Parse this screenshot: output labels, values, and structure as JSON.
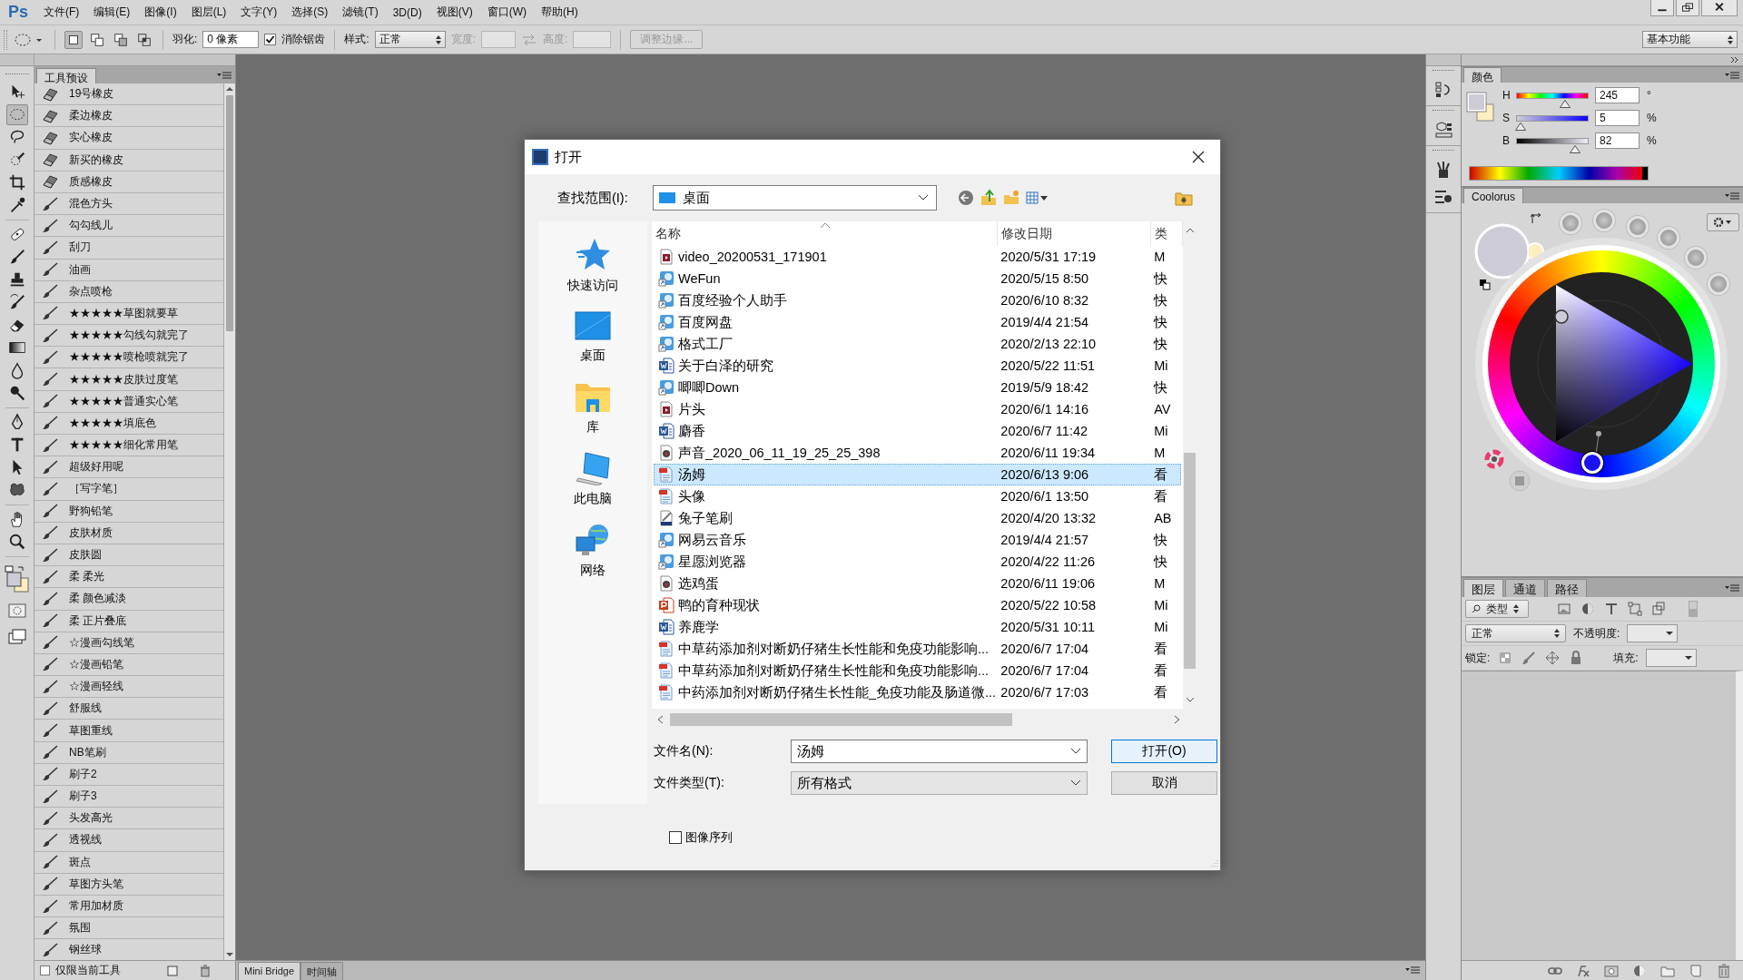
{
  "menu_bar": {
    "logo": "Ps",
    "items": [
      "文件(F)",
      "编辑(E)",
      "图像(I)",
      "图层(L)",
      "文字(Y)",
      "选择(S)",
      "滤镜(T)",
      "3D(D)",
      "视图(V)",
      "窗口(W)",
      "帮助(H)"
    ]
  },
  "options_bar": {
    "selection_modes": [
      {
        "selected": true
      },
      {
        "selected": false
      },
      {
        "selected": false
      },
      {
        "selected": false
      }
    ],
    "feather_label": "羽化:",
    "feather_value": "0 像素",
    "antialias": {
      "label": "消除锯齿",
      "checked": true
    },
    "style_label": "样式:",
    "style_value": "正常",
    "width_field": {
      "label": "宽度:",
      "disabled": true
    },
    "height_field": {
      "label": "高度:",
      "disabled": true
    },
    "refine_edge": {
      "label": "调整边缘...",
      "disabled": true
    },
    "workspace": "基本功能"
  },
  "tools": [
    {
      "selected": false
    },
    {
      "selected": true
    },
    {
      "selected": false
    },
    {
      "selected": false
    },
    {
      "selected": false
    },
    {
      "selected": false
    },
    {
      "selected": false
    },
    {
      "selected": false
    },
    {
      "selected": false
    },
    {
      "selected": false
    },
    {
      "selected": false
    },
    {
      "selected": false
    },
    {
      "selected": false
    },
    {
      "selected": false
    },
    {
      "selected": false
    },
    {
      "selected": false
    },
    {
      "selected": false
    },
    {
      "selected": false
    },
    {
      "selected": false
    },
    {
      "selected": false
    }
  ],
  "tool_presets": {
    "title": "工具预设",
    "items": [
      {
        "label": "19号橡皮",
        "kind": "eraser"
      },
      {
        "label": "柔边橡皮",
        "kind": "eraser"
      },
      {
        "label": "实心橡皮",
        "kind": "eraser"
      },
      {
        "label": "新买的橡皮",
        "kind": "eraser"
      },
      {
        "label": "质感橡皮",
        "kind": "eraser"
      },
      {
        "label": "混色方头",
        "kind": "brush"
      },
      {
        "label": "勾勾线儿",
        "kind": "brush"
      },
      {
        "label": "刮刀",
        "kind": "brush"
      },
      {
        "label": "油画",
        "kind": "brush"
      },
      {
        "label": "杂点喷枪",
        "kind": "brush"
      },
      {
        "label": "★★★★★草图就要草",
        "kind": "brush"
      },
      {
        "label": "★★★★★勾线勾就完了",
        "kind": "brush"
      },
      {
        "label": "★★★★★喷枪喷就完了",
        "kind": "brush"
      },
      {
        "label": "★★★★★皮肤过度笔",
        "kind": "brush"
      },
      {
        "label": "★★★★★普通实心笔",
        "kind": "brush"
      },
      {
        "label": "★★★★★填底色",
        "kind": "brush"
      },
      {
        "label": "★★★★★细化常用笔",
        "kind": "brush"
      },
      {
        "label": "超级好用呢",
        "kind": "brush"
      },
      {
        "label": "［写字笔］",
        "kind": "brush"
      },
      {
        "label": "野狗铅笔",
        "kind": "brush"
      },
      {
        "label": "皮肤材质",
        "kind": "brush"
      },
      {
        "label": "皮肤圆",
        "kind": "brush"
      },
      {
        "label": "柔 柔光",
        "kind": "brush"
      },
      {
        "label": "柔 颜色减淡",
        "kind": "brush"
      },
      {
        "label": "柔 正片叠底",
        "kind": "brush"
      },
      {
        "label": "☆漫画勾线笔",
        "kind": "brush"
      },
      {
        "label": "☆漫画铅笔",
        "kind": "brush"
      },
      {
        "label": "☆漫画轻线",
        "kind": "brush"
      },
      {
        "label": "舒服线",
        "kind": "brush"
      },
      {
        "label": "草图重线",
        "kind": "brush"
      },
      {
        "label": "NB笔刷",
        "kind": "brush"
      },
      {
        "label": "刷子2",
        "kind": "brush"
      },
      {
        "label": "刷子3",
        "kind": "brush"
      },
      {
        "label": "头发高光",
        "kind": "brush"
      },
      {
        "label": "透视线",
        "kind": "brush"
      },
      {
        "label": "斑点",
        "kind": "brush"
      },
      {
        "label": "草图方头笔",
        "kind": "brush"
      },
      {
        "label": "常用加材质",
        "kind": "brush"
      },
      {
        "label": "氛围",
        "kind": "brush"
      },
      {
        "label": "钢丝球",
        "kind": "brush"
      }
    ],
    "current_tool_only": {
      "label": "仅限当前工具",
      "checked": false
    }
  },
  "open_dialog": {
    "title": "打开",
    "look_in_label": "查找范围(I):",
    "look_in_value": "桌面",
    "places": [
      {
        "label": "快速访问",
        "kind": "quick"
      },
      {
        "label": "桌面",
        "kind": "desktop"
      },
      {
        "label": "库",
        "kind": "library"
      },
      {
        "label": "此电脑",
        "kind": "computer"
      },
      {
        "label": "网络",
        "kind": "network"
      }
    ],
    "columns": [
      "名称",
      "修改日期",
      "类"
    ],
    "rows": [
      {
        "name": "video_20200531_171901",
        "date": "2020/5/31 17:19",
        "type": "M",
        "kind": "video",
        "selected": false
      },
      {
        "name": "WeFun",
        "date": "2020/5/15 8:50",
        "type": "快",
        "kind": "shortcut",
        "selected": false
      },
      {
        "name": "百度经验个人助手",
        "date": "2020/6/10 8:32",
        "type": "快",
        "kind": "shortcut",
        "selected": false
      },
      {
        "name": "百度网盘",
        "date": "2019/4/4 21:54",
        "type": "快",
        "kind": "shortcut",
        "selected": false
      },
      {
        "name": "格式工厂",
        "date": "2020/2/13 22:10",
        "type": "快",
        "kind": "shortcut",
        "selected": false
      },
      {
        "name": "关于白泽的研究",
        "date": "2020/5/22 11:51",
        "type": "Mi",
        "kind": "word",
        "selected": false
      },
      {
        "name": "唧唧Down",
        "date": "2019/5/9 18:42",
        "type": "快",
        "kind": "shortcut",
        "selected": false
      },
      {
        "name": "片头",
        "date": "2020/6/1 14:16",
        "type": "AV",
        "kind": "video",
        "selected": false
      },
      {
        "name": "麝香",
        "date": "2020/6/7 11:42",
        "type": "Mi",
        "kind": "word",
        "selected": false
      },
      {
        "name": "声音_2020_06_11_19_25_25_398",
        "date": "2020/6/11 19:34",
        "type": "M",
        "kind": "audio",
        "selected": false
      },
      {
        "name": "汤姆",
        "date": "2020/6/13 9:06",
        "type": "看",
        "kind": "image",
        "selected": true
      },
      {
        "name": "头像",
        "date": "2020/6/1 13:50",
        "type": "看",
        "kind": "image",
        "selected": false
      },
      {
        "name": "兔子笔刷",
        "date": "2020/4/20 13:32",
        "type": "AB",
        "kind": "brush",
        "selected": false
      },
      {
        "name": "网易云音乐",
        "date": "2019/4/4 21:57",
        "type": "快",
        "kind": "shortcut",
        "selected": false
      },
      {
        "name": "星愿浏览器",
        "date": "2020/4/22 11:26",
        "type": "快",
        "kind": "shortcut",
        "selected": false
      },
      {
        "name": "选鸡蛋",
        "date": "2020/6/11 19:06",
        "type": "M",
        "kind": "audio",
        "selected": false
      },
      {
        "name": "鸭的育种现状",
        "date": "2020/5/22 10:58",
        "type": "Mi",
        "kind": "ppt",
        "selected": false
      },
      {
        "name": "养鹿学",
        "date": "2020/5/31 10:11",
        "type": "Mi",
        "kind": "word",
        "selected": false
      },
      {
        "name": "中草药添加剂对断奶仔猪生长性能和免疫功能影响...",
        "date": "2020/6/7 17:04",
        "type": "看",
        "kind": "image",
        "selected": false
      },
      {
        "name": "中草药添加剂对断奶仔猪生长性能和免疫功能影响...",
        "date": "2020/6/7 17:04",
        "type": "看",
        "kind": "image",
        "selected": false
      },
      {
        "name": "中药添加剂对断奶仔猪生长性能_免疫功能及肠道微...",
        "date": "2020/6/7 17:03",
        "type": "看",
        "kind": "image",
        "selected": false
      }
    ],
    "file_name_label": "文件名(N):",
    "file_name_value": "汤姆",
    "file_type_label": "文件类型(T):",
    "file_type_value": "所有格式",
    "open_button": "打开(O)",
    "cancel_button": "取消",
    "image_sequence": {
      "label": "图像序列",
      "checked": false
    }
  },
  "bottom_panel": {
    "tabs": [
      {
        "label": "Mini Bridge",
        "selected": true
      },
      {
        "label": "时间轴",
        "selected": false
      }
    ]
  },
  "color_panel": {
    "title": "颜色",
    "channels": [
      {
        "label": "H",
        "value": "245",
        "unit": "°",
        "level": 0.68
      },
      {
        "label": "S",
        "value": "5",
        "unit": "%",
        "level": 0.05
      },
      {
        "label": "B",
        "value": "82",
        "unit": "%",
        "level": 0.82
      }
    ]
  },
  "coolorus_panel": {
    "title": "Coolorus"
  },
  "layers_panel": {
    "tabs": [
      {
        "label": "图层",
        "selected": true
      },
      {
        "label": "通道",
        "selected": false
      },
      {
        "label": "路径",
        "selected": false
      }
    ],
    "filter": "类型",
    "blend_mode": "正常",
    "opacity_label": "不透明度:",
    "lock_label": "锁定:",
    "fill_label": "填充:"
  }
}
